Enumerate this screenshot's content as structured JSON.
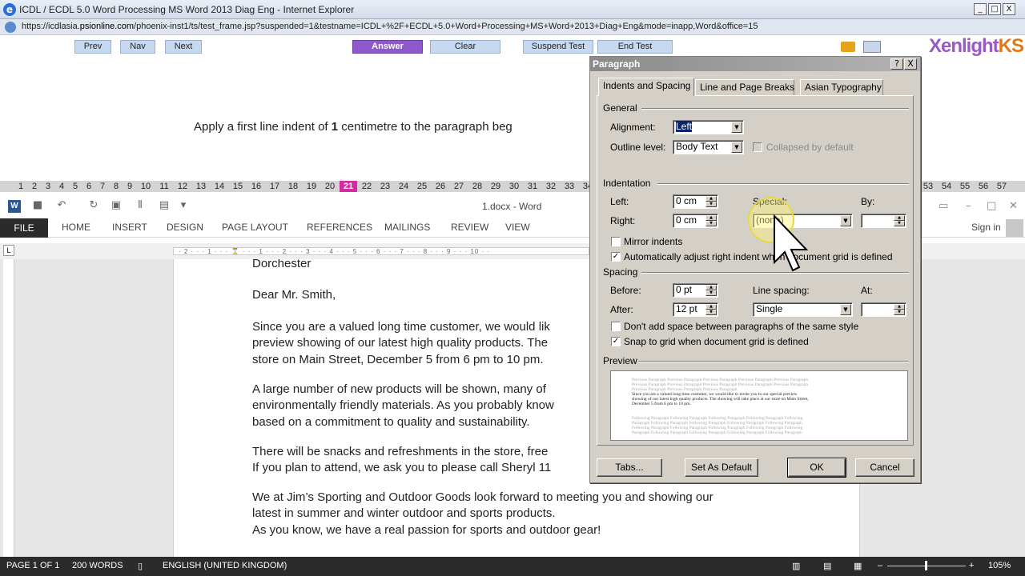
{
  "browser": {
    "title": "ICDL / ECDL 5.0 Word Processing MS Word 2013 Diag Eng - Internet Explorer",
    "url_prefix": "https://icdlasia.",
    "url_domain": "psionline.com",
    "url_rest": "/phoenix-inst1/ts/test_frame.jsp?suspended=1&testname=ICDL+%2F+ECDL+5.0+Word+Processing+MS+Word+2013+Diag+Eng&mode=inapp,Word&office=15",
    "window_buttons": [
      "_",
      "□",
      "X"
    ]
  },
  "test_toolbar": {
    "prev": "Prev",
    "nav": "Nav",
    "next": "Next",
    "answer": "Answer",
    "clear": "Clear",
    "suspend": "Suspend Test",
    "end": "End Test",
    "brand_a": "Xenlight",
    "brand_b": "KS"
  },
  "question": {
    "prefix": "Apply a first line indent of ",
    "bold": "1",
    "suffix": " centimetre to the paragraph beg"
  },
  "question_numbers": {
    "left": [
      "1",
      "2",
      "3",
      "4",
      "5",
      "6",
      "7",
      "8",
      "9",
      "10",
      "11",
      "12",
      "13",
      "14",
      "15",
      "16",
      "17",
      "18",
      "19",
      "20",
      "21",
      "22",
      "23",
      "24",
      "25",
      "26",
      "27",
      "28",
      "29",
      "30",
      "31",
      "32",
      "33",
      "34"
    ],
    "right": [
      "53",
      "54",
      "55",
      "56",
      "57"
    ],
    "current": "21"
  },
  "word": {
    "doc_title": "1.docx - Word",
    "tabs": [
      "FILE",
      "HOME",
      "INSERT",
      "DESIGN",
      "PAGE LAYOUT",
      "REFERENCES",
      "MAILINGS",
      "REVIEW",
      "VIEW"
    ],
    "sign_in": "Sign in",
    "ruler_text": "· 2 · · · 1 · · · ⌛ · · · 1 · · · 2 · · · 3 · · · 4 · · · 5 · · · 6 · · · 7 · · · 8 · · · 9 · · · 10 · ·",
    "paragraphs": [
      "Dorchester",
      "Dear Mr. Smith,",
      "Since you are a valued long time customer, we would lik",
      "preview showing of our latest high quality products. The",
      "store on Main Street, December 5 from 6 pm to 10 pm.",
      "A large number of new products will be shown, many of",
      "environmentally friendly materials. As you probably know",
      "based on a commitment to quality and sustainability.",
      "There will be snacks and refreshments in the store, free",
      "If you plan to attend, we ask you to please call Sheryl 11",
      "We at Jim’s Sporting and Outdoor Goods look forward to meeting you and showing our",
      "latest in summer and winter outdoor and sports products.",
      "As you know, we have a real passion for sports and outdoor gear!"
    ],
    "status": {
      "page": "PAGE 1 OF 1",
      "words": "200 WORDS",
      "language": "ENGLISH (UNITED KINGDOM)",
      "zoom": "105%"
    }
  },
  "dialog": {
    "title": "Paragraph",
    "help_btn": "?",
    "close_btn": "X",
    "tabs": [
      "Indents and Spacing",
      "Line and Page Breaks",
      "Asian Typography"
    ],
    "general": {
      "heading": "General",
      "alignment_label": "Alignment:",
      "alignment_value": "Left",
      "outline_label": "Outline level:",
      "outline_value": "Body Text",
      "collapsed_label": "Collapsed by default"
    },
    "indentation": {
      "heading": "Indentation",
      "left_label": "Left:",
      "left_value": "0 cm",
      "right_label": "Right:",
      "right_value": "0 cm",
      "special_label": "Special:",
      "special_value": "(none)",
      "by_label": "By:",
      "by_value": "",
      "mirror_label": "Mirror indents",
      "auto_adjust_label": "Automatically adjust right indent when document grid is defined"
    },
    "spacing": {
      "heading": "Spacing",
      "before_label": "Before:",
      "before_value": "0 pt",
      "after_label": "After:",
      "after_value": "12 pt",
      "line_spacing_label": "Line spacing:",
      "line_spacing_value": "Single",
      "at_label": "At:",
      "at_value": "",
      "dont_add_label": "Don't add space between paragraphs of the same style",
      "snap_label": "Snap to grid when document grid is defined"
    },
    "preview": {
      "heading": "Preview",
      "prev_lines": [
        "Previous Paragraph Previous Paragraph Previous Paragraph Previous Paragraph Previous Paragraph",
        "Previous Paragraph Previous Paragraph Previous Paragraph Previous Paragraph Previous Paragraph",
        "Previous Paragraph Previous Paragraph Previous Paragraph"
      ],
      "current_lines": [
        "Since you are a valued long time customer, we would like to invite you to our special preview",
        "showing of our latest high quality products. The showing will take place at our store on Main Street,",
        "December 5 from 6 pm to 10 pm."
      ],
      "next_lines": [
        "Following Paragraph Following Paragraph Following Paragraph Following Paragraph Following",
        "Paragraph Following Paragraph Following Paragraph Following Paragraph Following Paragraph",
        "Following Paragraph Following Paragraph Following Paragraph Following Paragraph Following",
        "Paragraph Following Paragraph Following Paragraph Following Paragraph Following Paragraph"
      ]
    },
    "buttons": {
      "tabs": "Tabs...",
      "set_default": "Set As Default",
      "ok": "OK",
      "cancel": "Cancel"
    }
  }
}
